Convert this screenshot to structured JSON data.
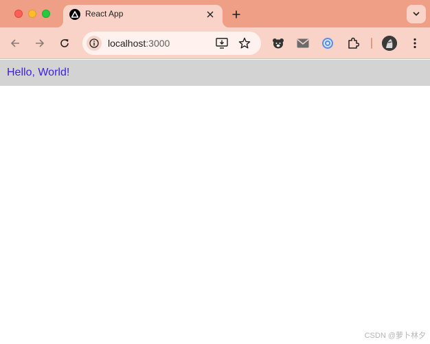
{
  "window": {
    "traffic_lights": [
      "close",
      "minimize",
      "zoom"
    ]
  },
  "tab": {
    "title": "React App",
    "favicon": "react-app-triangle-icon"
  },
  "toolbar": {
    "url_host": "localhost",
    "url_port": ":3000"
  },
  "page": {
    "header_text": "Hello, World!",
    "header_bg": "#d3d3d3",
    "header_text_color": "#3c1cf2"
  },
  "colors": {
    "tabbar": "#ef9f86",
    "toolbar": "#fad3c8"
  },
  "watermark": "CSDN @萝卜林夕"
}
